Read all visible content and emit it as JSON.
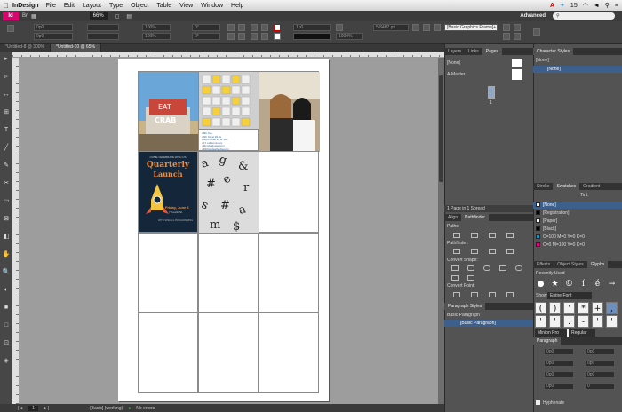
{
  "menubar": {
    "apple": "",
    "app": "InDesign",
    "items": [
      "File",
      "Edit",
      "Layout",
      "Type",
      "Object",
      "Table",
      "View",
      "Window",
      "Help"
    ],
    "right": [
      "15"
    ]
  },
  "appbar": {
    "logo": "Id",
    "zoom": "66%",
    "workspace": "Advanced",
    "search_placeholder": ""
  },
  "control": {
    "fields": [
      "0p0",
      "0p0",
      "100%",
      "100%",
      "0°",
      "0°",
      "1p0",
      "5.8487 pt",
      "1000%"
    ],
    "frame_style": "[Basic Graphics Frame]+"
  },
  "tabs": [
    "*Untitled-8 @ 300%",
    "*Untitled-10 @ 65%"
  ],
  "status": {
    "page": "1",
    "style": "[Basic] (working)",
    "errors": "No errors"
  },
  "tools": [
    "▸",
    "▹",
    "↔",
    "⊞",
    "T",
    "╱",
    "✎",
    "✂",
    "▭",
    "⊠",
    "◧",
    "✋",
    "🔍",
    "◐",
    "■",
    "□",
    "⊡",
    "◈"
  ],
  "layout": {
    "photo_text_lines": [
      "• 8th Ave.",
      "• 4th St. at 29 Av",
      "• fwd Partial 20 of 100",
      "• 17 edi summary",
      "• #tmcMidupsemon",
      "• #20/ondsathodnecom"
    ],
    "poster_top": "COME CELEBRATE WITH US",
    "poster_title_1": "Quarterly",
    "poster_title_2": "Launch",
    "poster_date": "Friday, June 6",
    "poster_date_2": "7 Fourth St.",
    "poster_sub": "WITH SPECIAL PROGRAMMING",
    "sign_1": "EAT",
    "sign_2": "CRAB"
  },
  "pages_panel": {
    "tabs": [
      "Layers",
      "Links",
      "Pages"
    ],
    "rows": [
      "[None]",
      "A-Master"
    ],
    "page_number": "1",
    "footer": "1 Page in 1 Spread"
  },
  "char_styles": {
    "tabs": [
      "Character Styles"
    ],
    "rows": [
      "[None]",
      "[None]"
    ]
  },
  "swatches": {
    "tabs": [
      "Stroke",
      "Swatches",
      "Gradient"
    ],
    "tint_label": "Tint:",
    "rows": [
      {
        "name": "[None]",
        "color": "#ffffff"
      },
      {
        "name": "[Registration]",
        "color": "#000000"
      },
      {
        "name": "[Paper]",
        "color": "#ffffff"
      },
      {
        "name": "[Black]",
        "color": "#000000"
      },
      {
        "name": "C=100 M=0 Y=0 K=0",
        "color": "#00a0e6"
      },
      {
        "name": "C=0 M=100 Y=0 K=0",
        "color": "#e6007e"
      }
    ]
  },
  "align": {
    "tabs": [
      "Align",
      "Pathfinder"
    ],
    "paths": "Paths:",
    "pathfinder": "Pathfinder:",
    "convert_shape": "Convert Shape:",
    "convert_point": "Convert Point:"
  },
  "para_styles": {
    "tabs": [
      "Paragraph Styles"
    ],
    "rows": [
      "Basic Paragraph",
      "[Basic Paragraph]"
    ]
  },
  "glyphs": {
    "tabs": [
      "Effects",
      "Object Styles",
      "Glyphs"
    ],
    "recently_used": "Recently Used",
    "recent": [
      "●",
      "★",
      "©",
      "í",
      "é",
      "→"
    ],
    "show_label": "Show:",
    "show_value": "Entire Font",
    "grid": [
      "(",
      ")",
      "'",
      "*",
      "+",
      ",",
      "'",
      "'",
      ".",
      "-",
      "'",
      "'",
      ".",
      "/",
      "'"
    ],
    "font": "Minion Pro",
    "style": "Regular"
  },
  "paragraph": {
    "tabs": [
      "Paragraph"
    ],
    "fields": [
      "0p0",
      "0p0",
      "0p0",
      "0p0",
      "0p0",
      "0p0",
      "0p0",
      "0"
    ],
    "hyphenate": "Hyphenate"
  }
}
